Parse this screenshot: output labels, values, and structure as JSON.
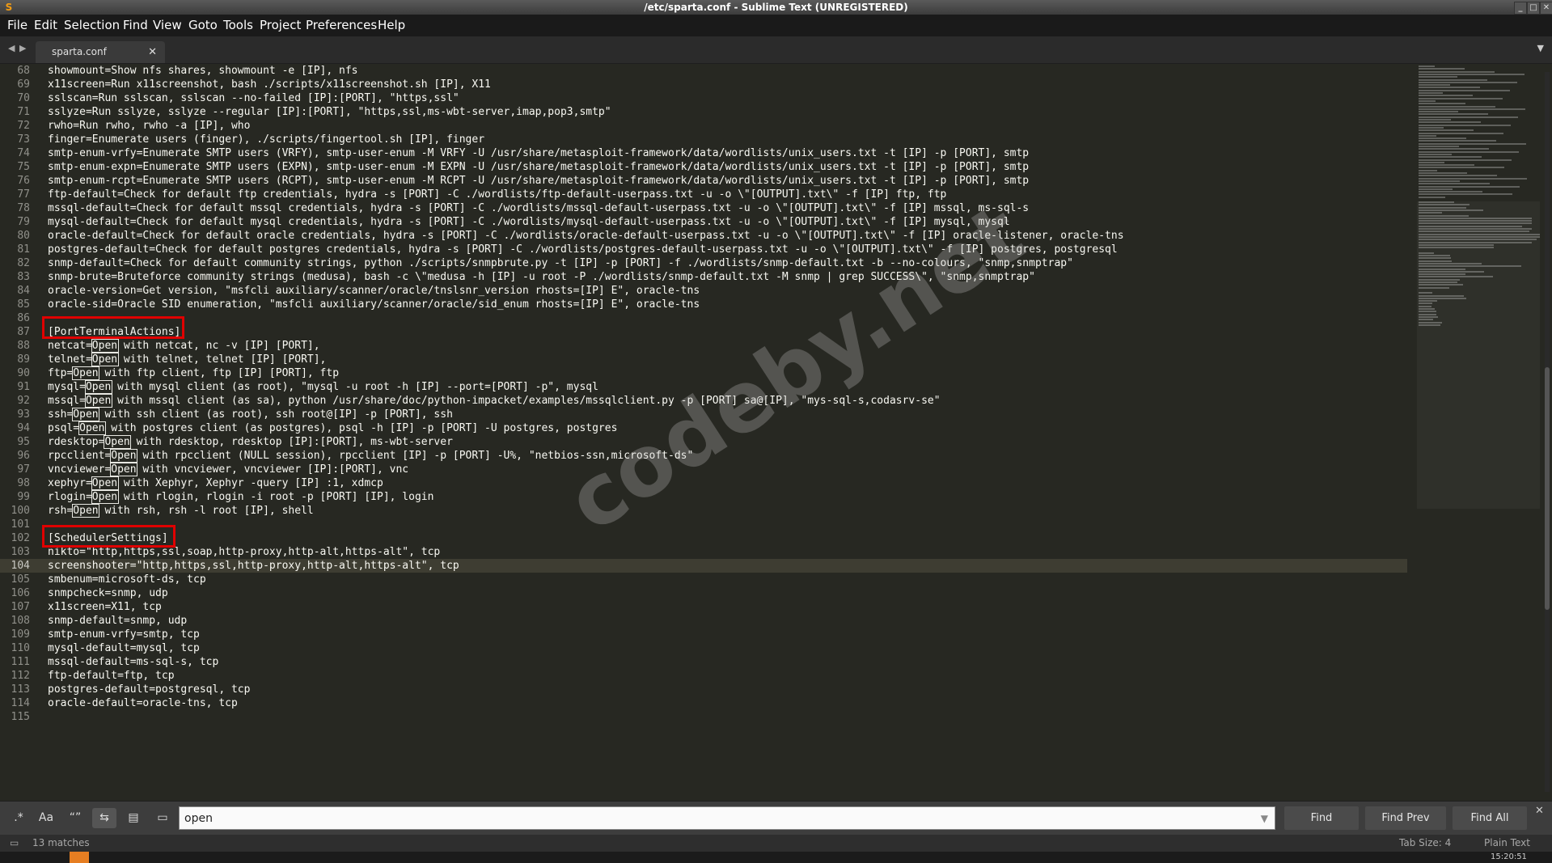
{
  "window": {
    "title": "/etc/sparta.conf - Sublime Text (UNREGISTERED)"
  },
  "menu": [
    "File",
    "Edit",
    "Selection",
    "Find",
    "View",
    "Goto",
    "Tools",
    "Project",
    "Preferences",
    "Help"
  ],
  "tab": {
    "label": "sparta.conf"
  },
  "editor": {
    "first_line_number": 68,
    "current_line": 104,
    "search_term": "Open",
    "lines": [
      "showmount=Show nfs shares, showmount -e [IP], nfs",
      "x11screen=Run x11screenshot, bash ./scripts/x11screenshot.sh [IP], X11",
      "sslscan=Run sslscan, sslscan --no-failed [IP]:[PORT], \"https,ssl\"",
      "sslyze=Run sslyze, sslyze --regular [IP]:[PORT], \"https,ssl,ms-wbt-server,imap,pop3,smtp\"",
      "rwho=Run rwho, rwho -a [IP], who",
      "finger=Enumerate users (finger), ./scripts/fingertool.sh [IP], finger",
      "smtp-enum-vrfy=Enumerate SMTP users (VRFY), smtp-user-enum -M VRFY -U /usr/share/metasploit-framework/data/wordlists/unix_users.txt -t [IP] -p [PORT], smtp",
      "smtp-enum-expn=Enumerate SMTP users (EXPN), smtp-user-enum -M EXPN -U /usr/share/metasploit-framework/data/wordlists/unix_users.txt -t [IP] -p [PORT], smtp",
      "smtp-enum-rcpt=Enumerate SMTP users (RCPT), smtp-user-enum -M RCPT -U /usr/share/metasploit-framework/data/wordlists/unix_users.txt -t [IP] -p [PORT], smtp",
      "ftp-default=Check for default ftp credentials, hydra -s [PORT] -C ./wordlists/ftp-default-userpass.txt -u -o \\\"[OUTPUT].txt\\\" -f [IP] ftp, ftp",
      "mssql-default=Check for default mssql credentials, hydra -s [PORT] -C ./wordlists/mssql-default-userpass.txt -u -o \\\"[OUTPUT].txt\\\" -f [IP] mssql, ms-sql-s",
      "mysql-default=Check for default mysql credentials, hydra -s [PORT] -C ./wordlists/mysql-default-userpass.txt -u -o \\\"[OUTPUT].txt\\\" -f [IP] mysql, mysql",
      "oracle-default=Check for default oracle credentials, hydra -s [PORT] -C ./wordlists/oracle-default-userpass.txt -u -o \\\"[OUTPUT].txt\\\" -f [IP] oracle-listener, oracle-tns",
      "postgres-default=Check for default postgres credentials, hydra -s [PORT] -C ./wordlists/postgres-default-userpass.txt -u -o \\\"[OUTPUT].txt\\\" -f [IP] postgres, postgresql",
      "snmp-default=Check for default community strings, python ./scripts/snmpbrute.py -t [IP] -p [PORT] -f ./wordlists/snmp-default.txt -b --no-colours, \"snmp,snmptrap\"",
      "snmp-brute=Bruteforce community strings (medusa), bash -c \\\"medusa -h [IP] -u root -P ./wordlists/snmp-default.txt -M snmp | grep SUCCESS\\\", \"snmp,snmptrap\"",
      "oracle-version=Get version, \"msfcli auxiliary/scanner/oracle/tnslsnr_version rhosts=[IP] E\", oracle-tns",
      "oracle-sid=Oracle SID enumeration, \"msfcli auxiliary/scanner/oracle/sid_enum rhosts=[IP] E\", oracle-tns",
      "",
      "[PortTerminalActions]",
      "netcat=Open with netcat, nc -v [IP] [PORT],",
      "telnet=Open with telnet, telnet [IP] [PORT],",
      "ftp=Open with ftp client, ftp [IP] [PORT], ftp",
      "mysql=Open with mysql client (as root), \"mysql -u root -h [IP] --port=[PORT] -p\", mysql",
      "mssql=Open with mssql client (as sa), python /usr/share/doc/python-impacket/examples/mssqlclient.py -p [PORT] sa@[IP], \"mys-sql-s,codasrv-se\"",
      "ssh=Open with ssh client (as root), ssh root@[IP] -p [PORT], ssh",
      "psql=Open with postgres client (as postgres), psql -h [IP] -p [PORT] -U postgres, postgres",
      "rdesktop=Open with rdesktop, rdesktop [IP]:[PORT], ms-wbt-server",
      "rpcclient=Open with rpcclient (NULL session), rpcclient [IP] -p [PORT] -U%, \"netbios-ssn,microsoft-ds\"",
      "vncviewer=Open with vncviewer, vncviewer [IP]:[PORT], vnc",
      "xephyr=Open with Xephyr, Xephyr -query [IP] :1, xdmcp",
      "rlogin=Open with rlogin, rlogin -i root -p [PORT] [IP], login",
      "rsh=Open with rsh, rsh -l root [IP], shell",
      "",
      "[SchedulerSettings]",
      "nikto=\"http,https,ssl,soap,http-proxy,http-alt,https-alt\", tcp",
      "screenshooter=\"http,https,ssl,http-proxy,http-alt,https-alt\", tcp",
      "smbenum=microsoft-ds, tcp",
      "snmpcheck=snmp, udp",
      "x11screen=X11, tcp",
      "snmp-default=snmp, udp",
      "smtp-enum-vrfy=smtp, tcp",
      "mysql-default=mysql, tcp",
      "mssql-default=ms-sql-s, tcp",
      "ftp-default=ftp, tcp",
      "postgres-default=postgresql, tcp",
      "oracle-default=oracle-tns, tcp",
      ""
    ]
  },
  "watermark": "codeby.net",
  "find": {
    "toggle_icons": [
      "regex-icon",
      "case-sensitive-icon",
      "whole-word-icon",
      "wrap-icon",
      "in-selection-icon",
      "highlight-matches-icon"
    ],
    "value": "open",
    "find_label": "Find",
    "find_prev_label": "Find Prev",
    "find_all_label": "Find All"
  },
  "status": {
    "matches": "13 matches",
    "tab_size": "Tab Size: 4",
    "syntax": "Plain Text"
  },
  "taskbar": {
    "clock": "15:20:51"
  },
  "colors": {
    "editor_bg": "#272822",
    "text": "#f8f8f2",
    "gutter_text": "#90908a",
    "current_line": "#3e3d32",
    "annotation_red": "#e00000"
  }
}
